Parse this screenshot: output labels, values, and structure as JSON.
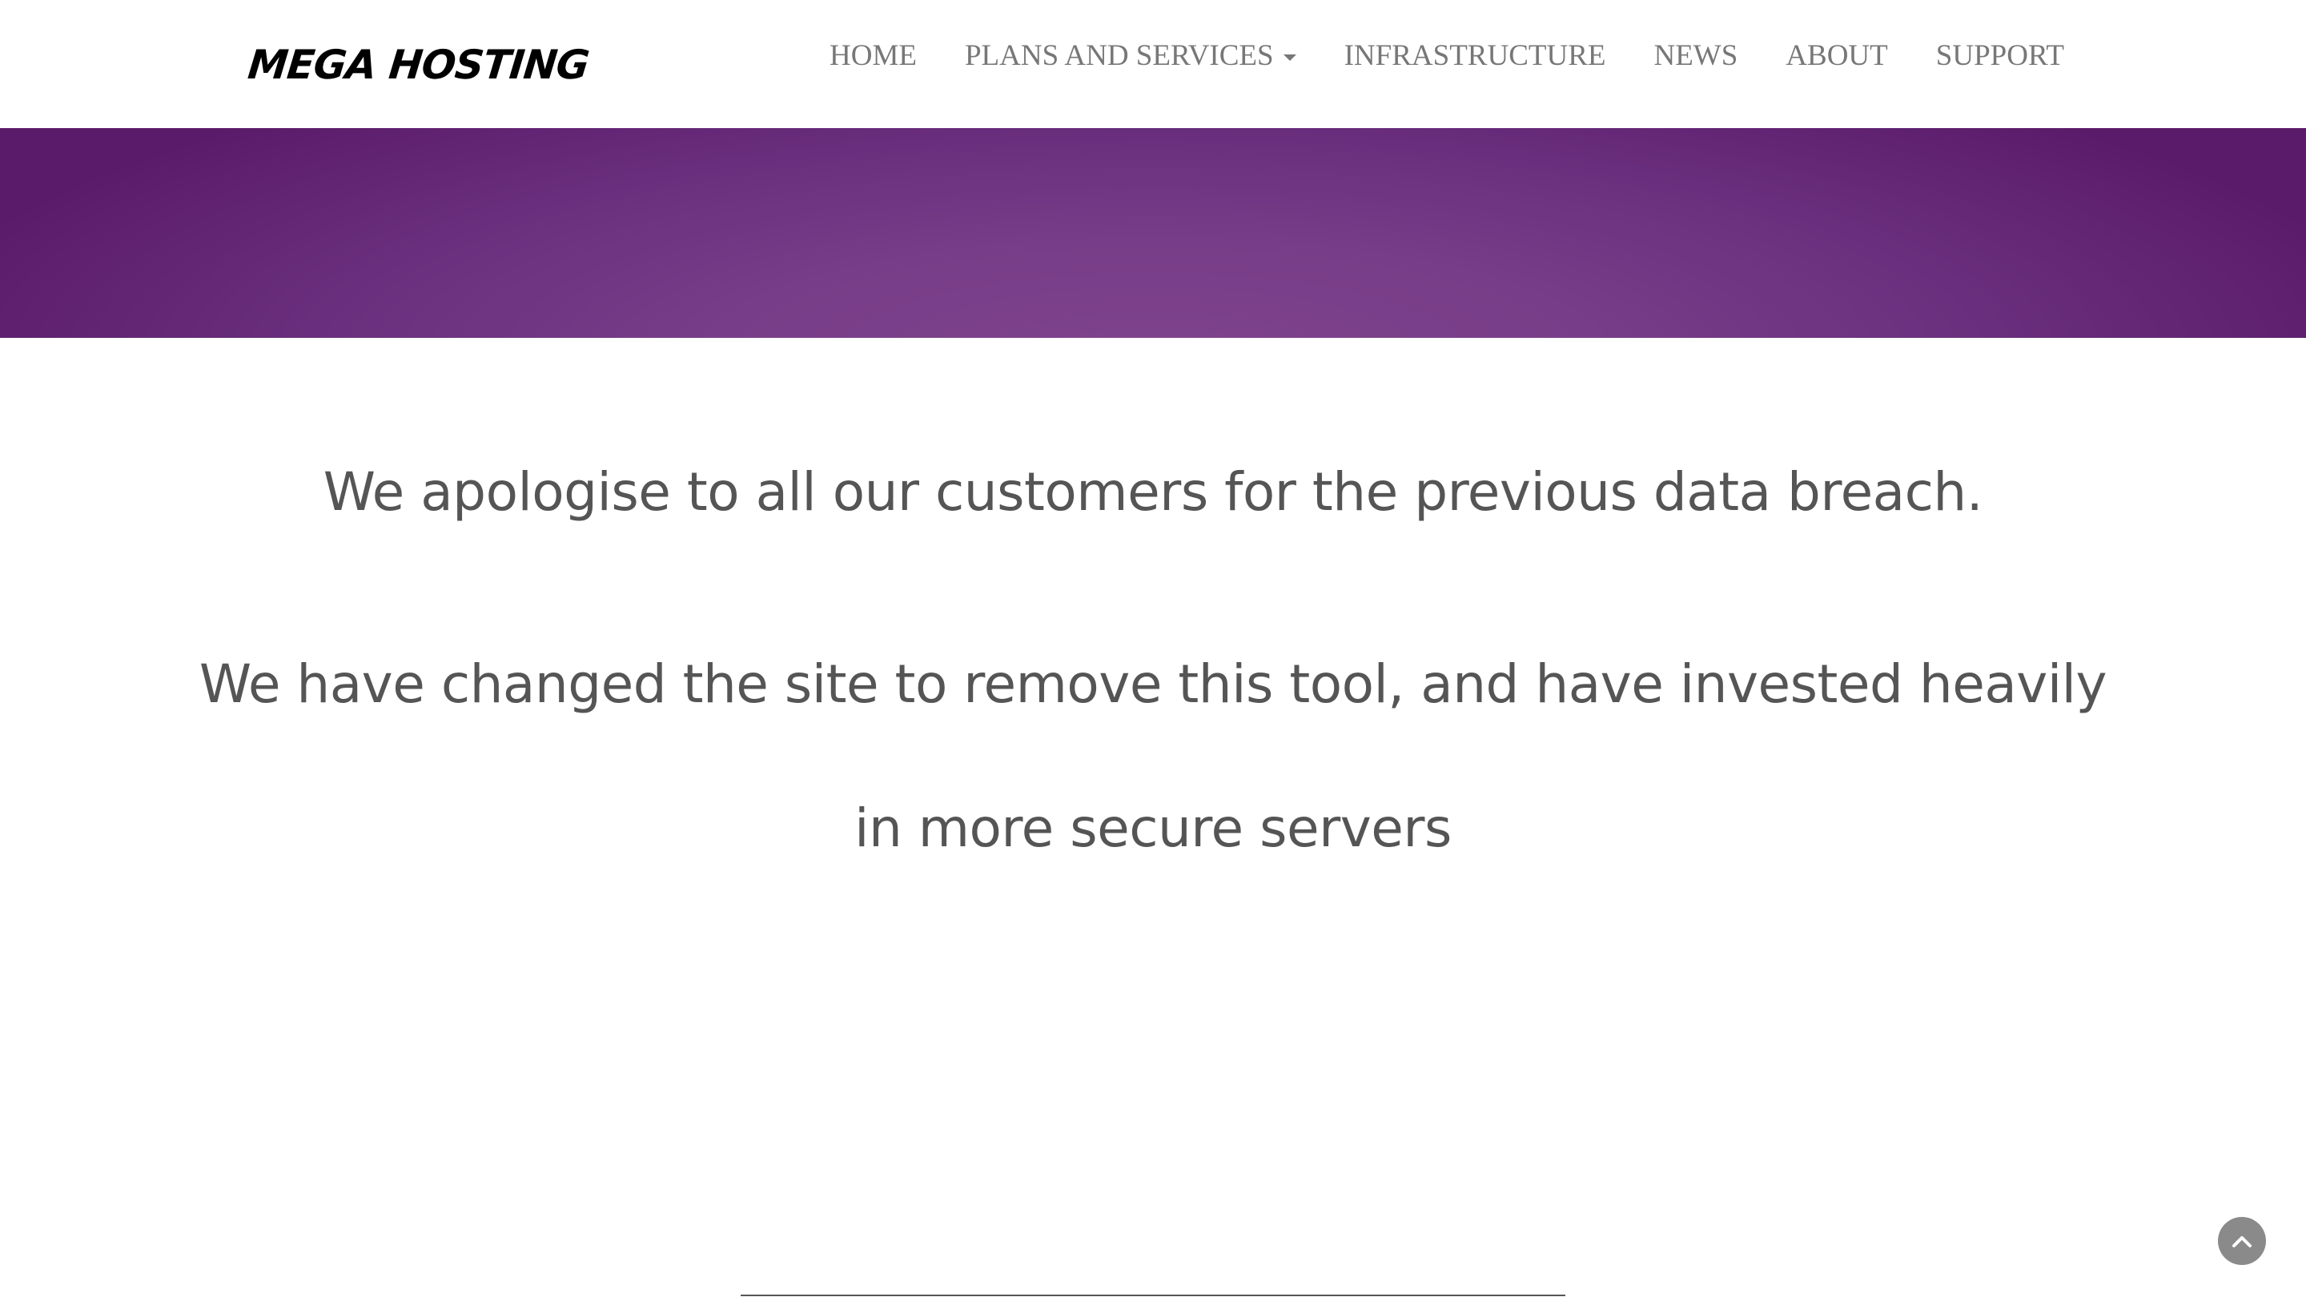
{
  "brand": {
    "name": "MEGA HOSTING"
  },
  "nav": {
    "items": [
      {
        "label": "HOME",
        "has_dropdown": false
      },
      {
        "label": "PLANS AND SERVICES",
        "has_dropdown": true
      },
      {
        "label": "INFRASTRUCTURE",
        "has_dropdown": false
      },
      {
        "label": "NEWS",
        "has_dropdown": false
      },
      {
        "label": "ABOUT",
        "has_dropdown": false
      },
      {
        "label": "SUPPORT",
        "has_dropdown": false
      }
    ]
  },
  "main": {
    "apology": "We apologise to all our customers for the previous data breach.",
    "changes_line1": "We have changed the site to remove this tool, and have invested heavily",
    "changes_line2": "in more secure servers"
  },
  "controls": {
    "scroll_top_icon": "chevron-up-icon"
  },
  "colors": {
    "banner_purple": "#6a2f7e",
    "nav_text": "#777777",
    "body_text": "#555555"
  }
}
